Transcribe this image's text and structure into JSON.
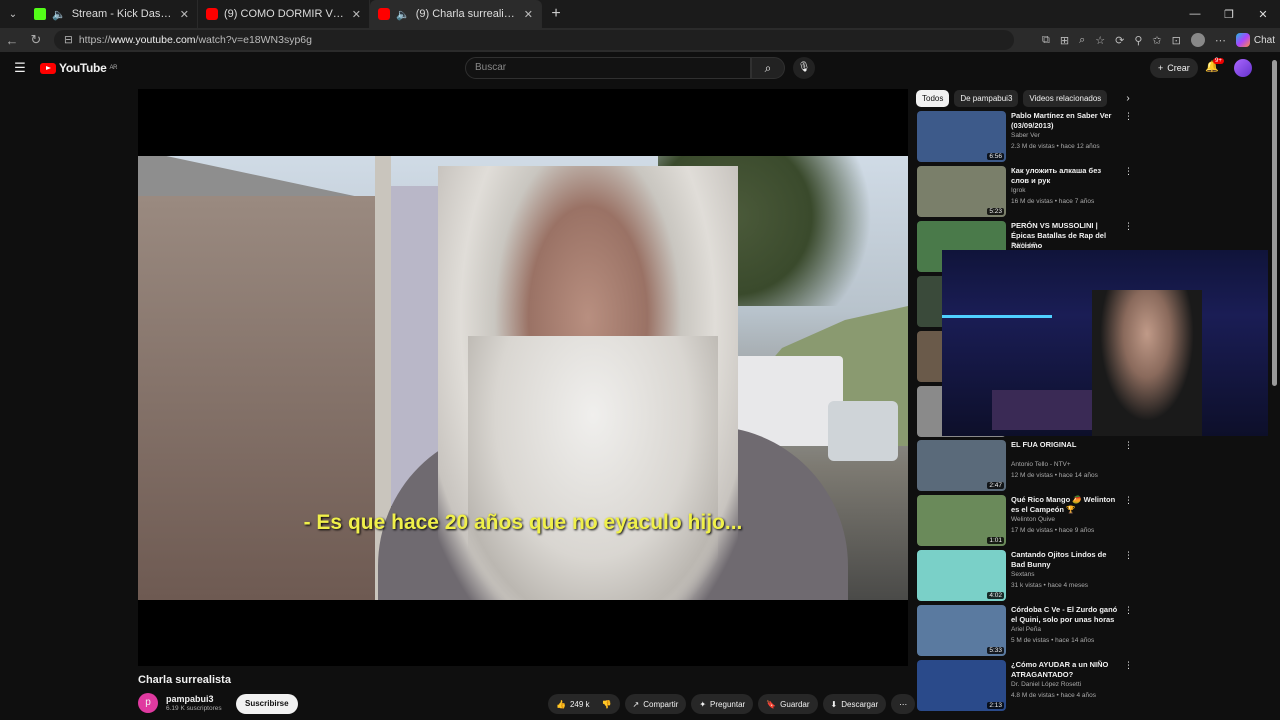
{
  "browser": {
    "tabs": [
      {
        "label": "Stream - Kick Dashboard",
        "favicon": "kick-icon"
      },
      {
        "label": "(9) COMO DORMIR VIDEO TUTORIAL",
        "favicon": "youtube-icon"
      },
      {
        "label": "(9) Charla surrealista - YouTube",
        "favicon": "youtube-icon",
        "active": true
      }
    ],
    "url_prefix": "https://",
    "url_host": "www.youtube.com",
    "url_path": "/watch?v=e18WN3syp6g",
    "chat_label": "Chat"
  },
  "youtube": {
    "logo_text": "YouTube",
    "logo_region": "AR",
    "search_placeholder": "Buscar",
    "create_label": "Crear",
    "notif_badge": "9+"
  },
  "video": {
    "subtitle": "- Es que hace 20 años que no eyaculo hijo...",
    "title": "Charla surrealista",
    "channel": "pampabui3",
    "channel_initial": "p",
    "subscribers": "6.19 K suscriptores",
    "subscribe_label": "Suscribirse",
    "likes": "249 k",
    "share_label": "Compartir",
    "ask_label": "Preguntar",
    "save_label": "Guardar",
    "download_label": "Descargar"
  },
  "sidebar": {
    "chips": [
      "Todos",
      "De pampabui3",
      "Videos relacionados"
    ],
    "items": [
      {
        "title": "Pablo Martínez en Saber Ver (03/09/2013)",
        "channel": "Saber Ver",
        "meta": "2.3 M de vistas • hace 12 años",
        "duration": "6:56",
        "thumb": "#3d5a8a"
      },
      {
        "title": "Как уложить алкаша без слов и рук",
        "channel": "Igrok",
        "meta": "16 M de vistas • hace 7 años",
        "duration": "5:23",
        "thumb": "#7a7f6a"
      },
      {
        "title": "PERÓN VS MUSSOLINI | Épicas Batallas de Rap del Racismo",
        "channel": "RAW-AP",
        "meta": "",
        "duration": "",
        "thumb": "#4a7a4a"
      },
      {
        "title": "",
        "channel": "",
        "meta": "",
        "duration": "",
        "thumb": "#3a4a3a"
      },
      {
        "title": "",
        "channel": "",
        "meta": "",
        "duration": "",
        "thumb": "#6a5a4a"
      },
      {
        "title": "",
        "channel": "",
        "meta": "",
        "duration": "",
        "thumb": "#8a8a8a"
      },
      {
        "title": "EL FUA ORIGINAL",
        "channel": "Antonio Tello - NTV+",
        "meta": "12 M de vistas • hace 14 años",
        "duration": "2:47",
        "thumb": "#5a6a7a"
      },
      {
        "title": "Qué Rico Mango 🥭 Welinton es el Campeón 🏆",
        "channel": "Welinton Quive",
        "meta": "17 M de vistas • hace 9 años",
        "duration": "1:01",
        "thumb": "#6a8a5a"
      },
      {
        "title": "Cantando Ojitos Lindos de Bad Bunny",
        "channel": "Sextans",
        "meta": "31 k vistas • hace 4 meses",
        "duration": "4:02",
        "thumb": "#7ad0c8"
      },
      {
        "title": "Córdoba C Ve - El Zurdo ganó el Quini, solo por unas horas",
        "channel": "Ariel Peña",
        "meta": "5 M de vistas • hace 14 años",
        "duration": "5:33",
        "thumb": "#5a7aa0"
      },
      {
        "title": "¿Cómo AYUDAR a un NIÑO ATRAGANTADO?",
        "channel": "Dr. Daniel López Rosetti",
        "meta": "4.8 M de vistas • hace 4 años",
        "duration": "2:13",
        "thumb": "#2a4a8a"
      }
    ]
  }
}
